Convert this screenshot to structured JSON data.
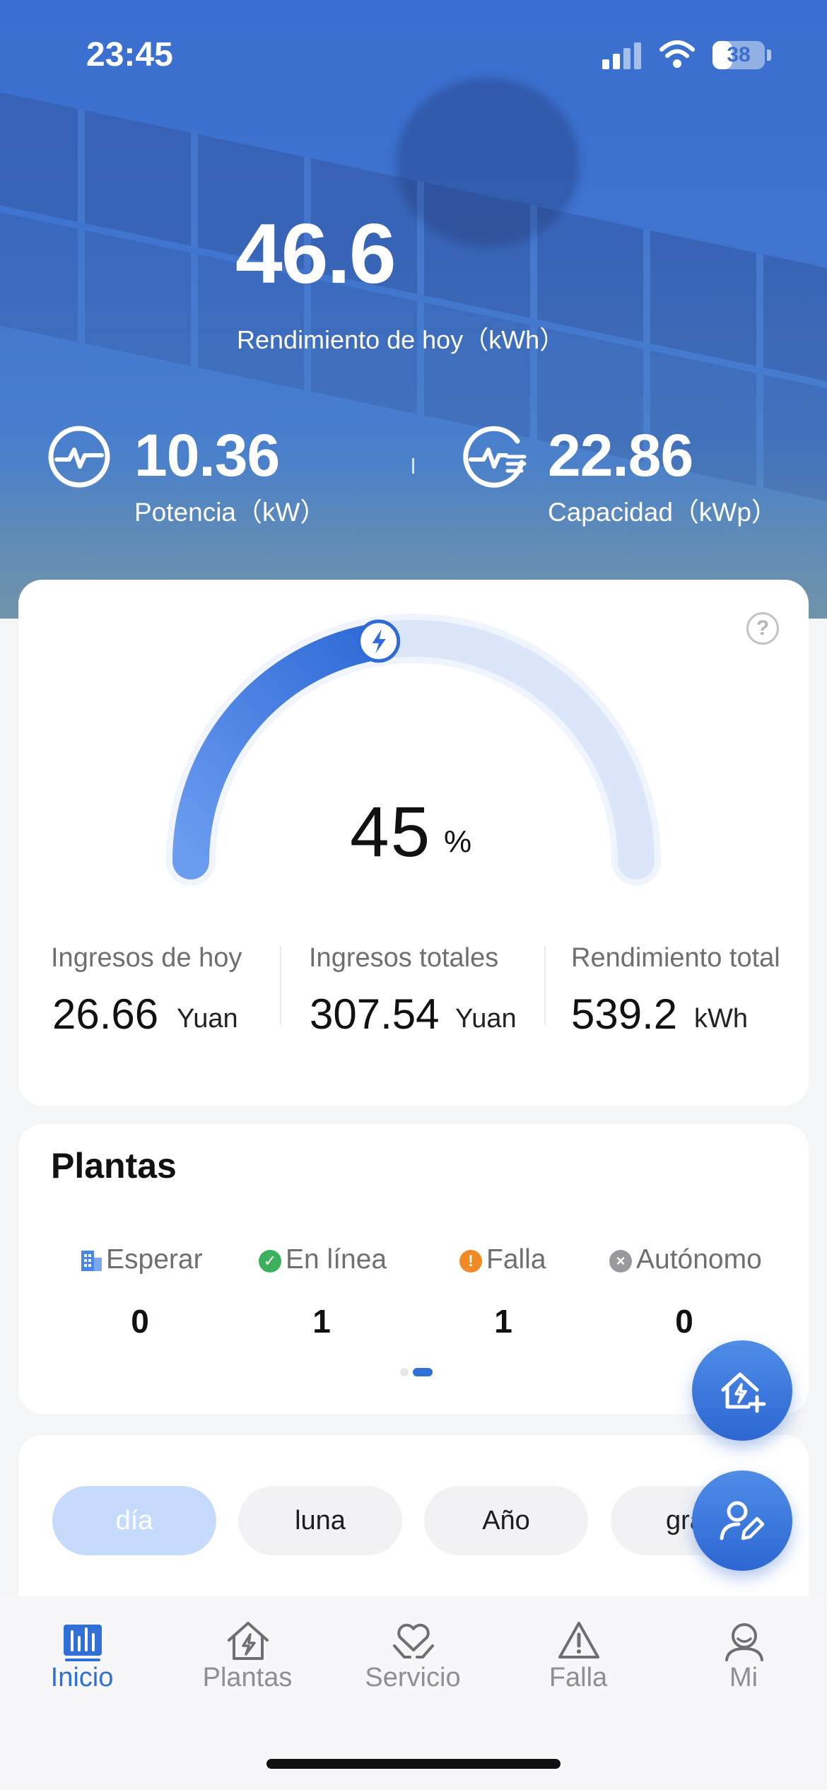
{
  "status_bar": {
    "time": "23:45",
    "battery": "38",
    "battery_level": 0.38
  },
  "hero": {
    "today_yield": "46.6",
    "today_yield_label": "Rendimiento de hoy（kWh）",
    "power_value": "10.36",
    "power_label": "Potencia（kW）",
    "capacity_value": "22.86",
    "capacity_label": "Capacidad（kWp）"
  },
  "gauge": {
    "value": "45",
    "unit": "%",
    "fraction": 0.45,
    "help": "?"
  },
  "stats": [
    {
      "label": "Ingresos de hoy",
      "value": "26.66",
      "unit": "Yuan"
    },
    {
      "label": "Ingresos totales",
      "value": "307.54",
      "unit": "Yuan"
    },
    {
      "label": "Rendimiento total",
      "value": "539.2",
      "unit": "kWh"
    }
  ],
  "plants": {
    "title": "Plantas",
    "statuses": [
      {
        "label": "Esperar",
        "count": "0",
        "icon": "building-icon",
        "color": "#4a86e8"
      },
      {
        "label": "En línea",
        "count": "1",
        "icon": "check-circle-icon",
        "color": "#3cb15c"
      },
      {
        "label": "Falla",
        "count": "1",
        "icon": "alert-circle-icon",
        "color": "#f08a24"
      },
      {
        "label": "Autónomo",
        "count": "0",
        "icon": "close-circle-icon",
        "color": "#9a9a9e"
      }
    ]
  },
  "periods": [
    "día",
    "luna",
    "Año",
    "gran"
  ],
  "nav": [
    {
      "label": "Inicio",
      "icon": "chart-icon",
      "active": true
    },
    {
      "label": "Plantas",
      "icon": "house-bolt-icon",
      "active": false
    },
    {
      "label": "Servicio",
      "icon": "heart-hands-icon",
      "active": false
    },
    {
      "label": "Falla",
      "icon": "warning-icon",
      "active": false
    },
    {
      "label": "Mi",
      "icon": "user-icon",
      "active": false
    }
  ],
  "colors": {
    "accent": "#2f6fd6",
    "hero": "#3a6ed0",
    "gauge_track": "#dce6fb"
  }
}
